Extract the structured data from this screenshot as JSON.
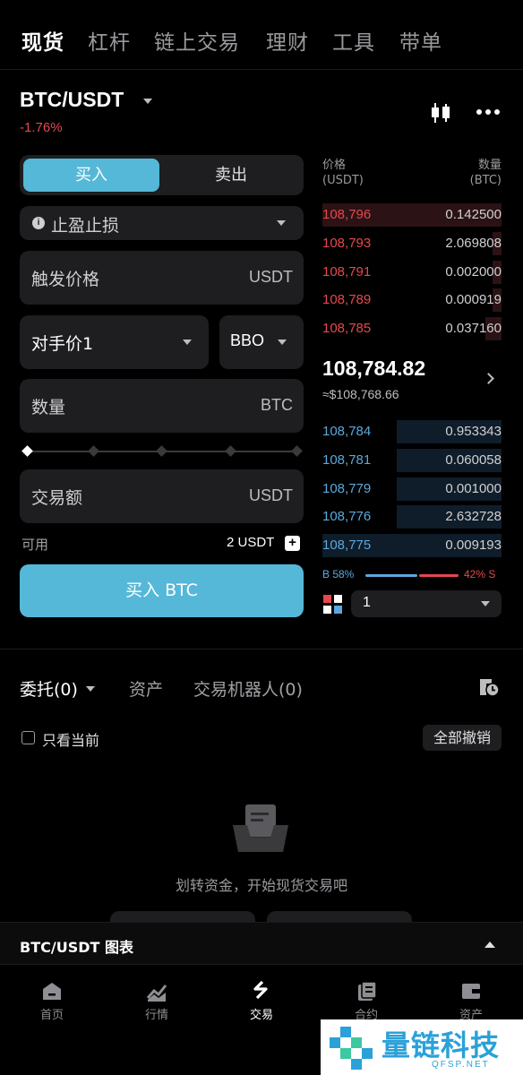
{
  "top_tabs": [
    "现货",
    "杠杆",
    "链上交易",
    "理财",
    "工具",
    "带单"
  ],
  "pair": {
    "symbol": "BTC/USDT",
    "change": "-1.76%"
  },
  "form": {
    "buy_label": "买入",
    "sell_label": "卖出",
    "order_type": "止盈止损",
    "trigger_label": "触发价格",
    "trigger_unit": "USDT",
    "price_mode": "对手价1",
    "bbo": "BBO",
    "qty_label": "数量",
    "qty_unit": "BTC",
    "amount_label": "交易额",
    "amount_unit": "USDT",
    "avail_label": "可用",
    "avail_value": "2 USDT",
    "submit_label": "买入 BTC",
    "slider_percent": 0
  },
  "orderbook": {
    "price_header": "价格",
    "price_unit": "(USDT)",
    "qty_header": "数量",
    "qty_unit": "(BTC)",
    "asks": [
      {
        "price": "108,796",
        "qty": "0.142500"
      },
      {
        "price": "108,793",
        "qty": "2.069808"
      },
      {
        "price": "108,791",
        "qty": "0.002000"
      },
      {
        "price": "108,789",
        "qty": "0.000919"
      },
      {
        "price": "108,785",
        "qty": "0.037160"
      }
    ],
    "last_price": "108,784.82",
    "last_usd": "≈$108,768.66",
    "bids": [
      {
        "price": "108,784",
        "qty": "0.953343"
      },
      {
        "price": "108,781",
        "qty": "0.060058"
      },
      {
        "price": "108,779",
        "qty": "0.001000"
      },
      {
        "price": "108,776",
        "qty": "2.632728"
      },
      {
        "price": "108,775",
        "qty": "0.009193"
      }
    ],
    "buy_ratio": "B 58%",
    "sell_ratio": "42% S",
    "precision": "1"
  },
  "orders": {
    "tab_orders": "委托(0)",
    "tab_assets": "资产",
    "tab_bots": "交易机器人(0)",
    "only_current": "只看当前",
    "cancel_all": "全部撤销",
    "empty_text": "划转资金，开始现货交易吧"
  },
  "chart_bar": {
    "title": "BTC/USDT 图表"
  },
  "nav": [
    "首页",
    "行情",
    "交易",
    "合约",
    "资产"
  ],
  "watermark": {
    "name": "量链科技",
    "site": "QFSP.NET"
  },
  "colors": {
    "accent": "#55b8d8",
    "ask": "#e5484d",
    "bid": "#5aa9dc"
  }
}
